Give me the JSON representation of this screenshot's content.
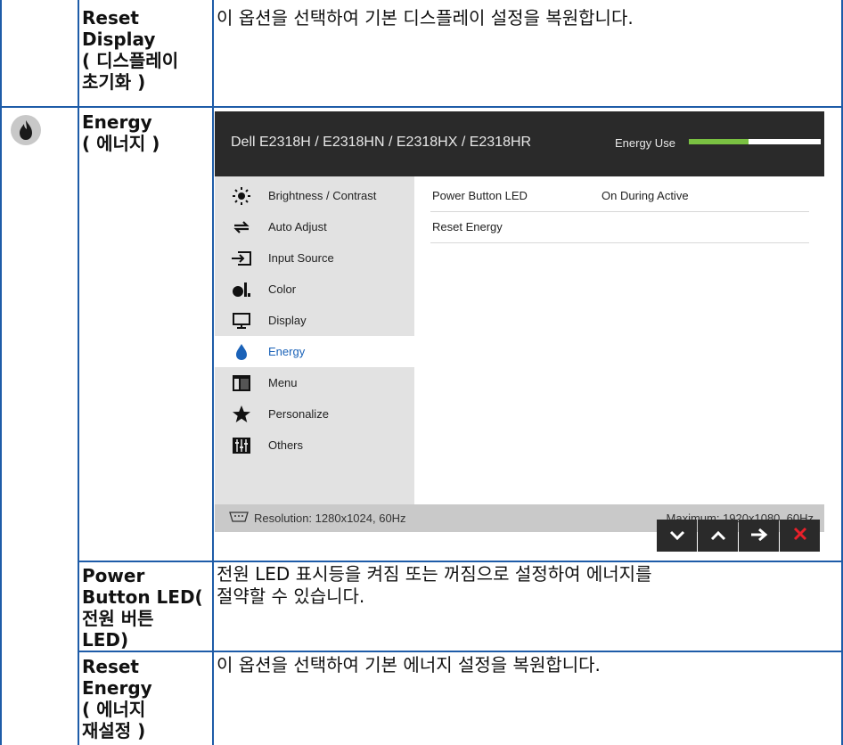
{
  "rows": [
    {
      "term": [
        "Reset",
        "Display",
        "( 디스플레이",
        "초기화 )"
      ],
      "description": "이 옵션을 선택하여 기본 디스플레이 설정을 복원합니다."
    },
    {
      "term": [
        "Energy",
        "( 에너지 )"
      ],
      "icon": "energy-flame-icon"
    },
    {
      "term": [
        "Power",
        "Button LED(",
        "전원 버튼",
        "LED)"
      ],
      "description": [
        "전원 LED 표시등을 켜짐 또는 꺼짐으로 설정하여 에너지를",
        "절약할 수 있습니다."
      ]
    },
    {
      "term": [
        "Reset",
        "Energy",
        "( 에너지",
        "재설정 )"
      ],
      "description": "이 옵션을 선택하여 기본 에너지 설정을 복원합니다."
    }
  ],
  "osd": {
    "model": "Dell E2318H / E2318HN / E2318HX / E2318HR",
    "energy_use_label": "Energy Use",
    "energy_use_level": 0.45,
    "colors": {
      "header": "#2a2a2a",
      "sidebar": "#e2e2e2",
      "active": "#1a62b8",
      "energy_fill": "#7ac142"
    },
    "menu": [
      {
        "label": "Brightness / Contrast",
        "icon": "brightness-sun-icon"
      },
      {
        "label": "Auto Adjust",
        "icon": "auto-adjust-icon"
      },
      {
        "label": "Input Source",
        "icon": "input-source-icon"
      },
      {
        "label": "Color",
        "icon": "color-icon"
      },
      {
        "label": "Display",
        "icon": "display-monitor-icon"
      },
      {
        "label": "Energy",
        "icon": "energy-drop-icon",
        "active": true
      },
      {
        "label": "Menu",
        "icon": "menu-window-icon"
      },
      {
        "label": "Personalize",
        "icon": "star-icon"
      },
      {
        "label": "Others",
        "icon": "others-sliders-icon"
      }
    ],
    "settings": [
      {
        "label": "Power Button LED",
        "value": "On During Active"
      },
      {
        "label": "Reset Energy",
        "value": ""
      }
    ],
    "footer": {
      "resolution": "Resolution: 1280x1024, 60Hz",
      "maximum": "Maximum: 1920x1080, 60Hz"
    },
    "nav_buttons": [
      "chevron-down-icon",
      "chevron-up-icon",
      "arrow-right-icon",
      "close-x-icon"
    ]
  }
}
